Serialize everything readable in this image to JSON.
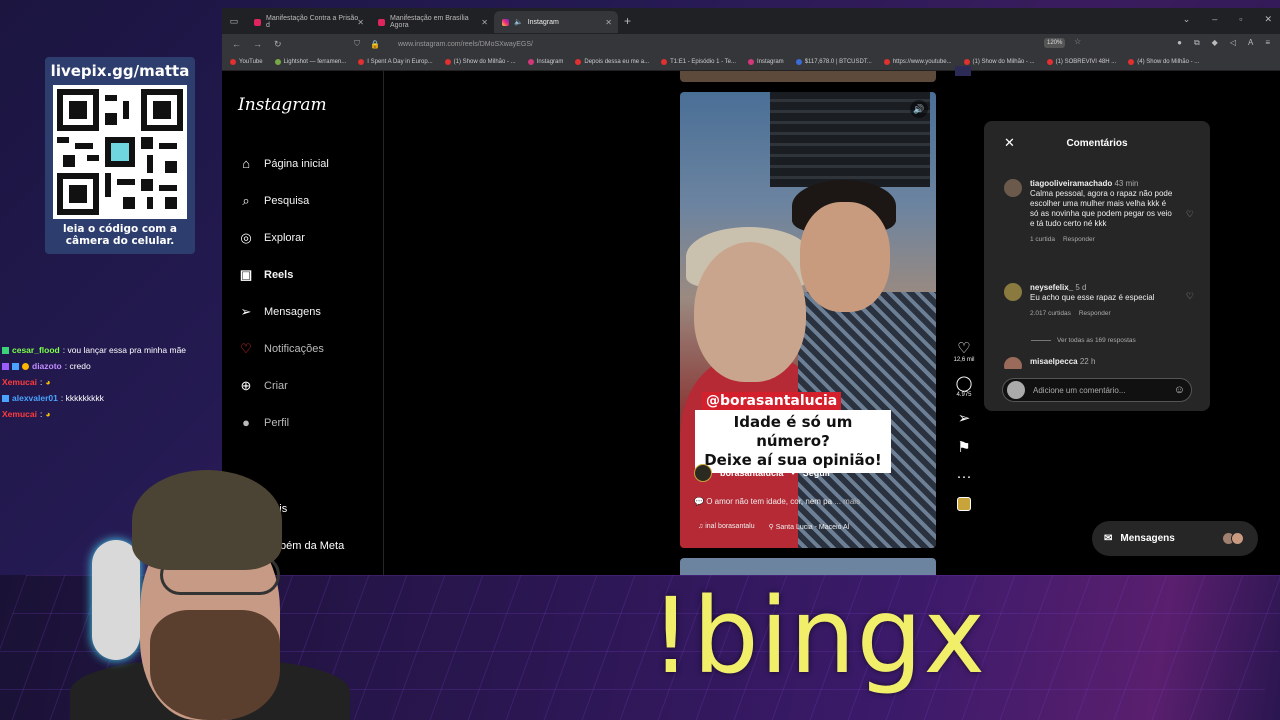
{
  "overlay": {
    "qr_title": "livepix.gg/matta",
    "qr_subtitle_1": "leia o código com a",
    "qr_subtitle_2": "câmera do celular.",
    "bingx": "!bingx",
    "chat": [
      {
        "user": "cesar_flood",
        "text": " : vou lançar essa pra minha mãe",
        "color": "#7cff4a"
      },
      {
        "user": "diazoto",
        "text": " : credo",
        "color": "#c18cff"
      },
      {
        "user": "Xemucai",
        "text": " : ",
        "color": "#ff3b3b"
      },
      {
        "user": "alexvaler01",
        "text": " : kkkkkkkkk",
        "color": "#4aa3ff"
      },
      {
        "user": "Xemucai",
        "text": " : ",
        "color": "#ff3b3b"
      }
    ]
  },
  "browser": {
    "tabs": [
      {
        "label": "Manifestação Contra a Prisão d"
      },
      {
        "label": "Manifestação em Brasília Agora"
      },
      {
        "label": "Instagram"
      }
    ],
    "url": "www.instagram.com/reels/DMoSXwayEGS/",
    "zoom": "120%",
    "bookmarks": [
      "YouTube",
      "Lightshot — ferramen...",
      "I Spent A Day in Europ...",
      "(1) Show do Milhão - ...",
      "Instagram",
      "Depois dessa eu me a...",
      "T1:E1 - Episódio 1 - Te...",
      "Instagram",
      "$117,678.0 | BTCUSDT...",
      "https://www.youtube...",
      "(1) Show do Milhão - ...",
      "(1) SOBREVIVI 48H ...",
      "(4) Show do Milhão - ..."
    ]
  },
  "instagram": {
    "logo": "Instagram",
    "menu": [
      {
        "label": "Página inicial",
        "icon": "home-icon",
        "glyph": "⌂"
      },
      {
        "label": "Pesquisa",
        "icon": "search-icon",
        "glyph": "⌕"
      },
      {
        "label": "Explorar",
        "icon": "compass-icon",
        "glyph": "◎"
      },
      {
        "label": "Reels",
        "icon": "reels-icon",
        "glyph": "▣"
      },
      {
        "label": "Mensagens",
        "icon": "send-icon",
        "glyph": "➢"
      },
      {
        "label": "Notificações",
        "icon": "heart-icon",
        "glyph": "♡"
      },
      {
        "label": "Criar",
        "icon": "plus-icon",
        "glyph": "⊕"
      },
      {
        "label": "Perfil",
        "icon": "avatar-icon",
        "glyph": "●"
      }
    ],
    "more": "Mais",
    "meta": "bém da Meta",
    "reel": {
      "handle_tag": "@borasantalucia",
      "caption_line1": "Idade é só um número?",
      "caption_line2": "Deixe aí sua opinião!",
      "author": "borasantalucia",
      "follow": "Seguir",
      "description": "O amor não tem idade, cor, nem pa",
      "description_more": "... mais",
      "audio": "inal   borasantalu",
      "location": "Santa Lucia - Maceió Al",
      "likes": "12,6 mil",
      "comments_count": "4.975"
    },
    "comments": {
      "title": "Comentários",
      "items": [
        {
          "user": "tiagooliveiramachado",
          "time": " 43 min",
          "text": "Calma pessoal, agora o rapaz não pode escolher uma mulher mais velha kkk é só as novinha que podem pegar os veio e tá tudo certo né kkk",
          "likes": "1 curtida",
          "reply": "Responder"
        },
        {
          "user": "neysefelix_",
          "time": " 5 d",
          "text": "Eu acho que esse rapaz é especial",
          "likes": "2.017 curtidas",
          "reply": "Responder"
        }
      ],
      "view_all": "Ver todas as 169 respostas",
      "partial_user": "misaelpecca",
      "partial_time": " 22 h",
      "placeholder": "Adicione um comentário..."
    },
    "messages_label": "Mensagens"
  }
}
